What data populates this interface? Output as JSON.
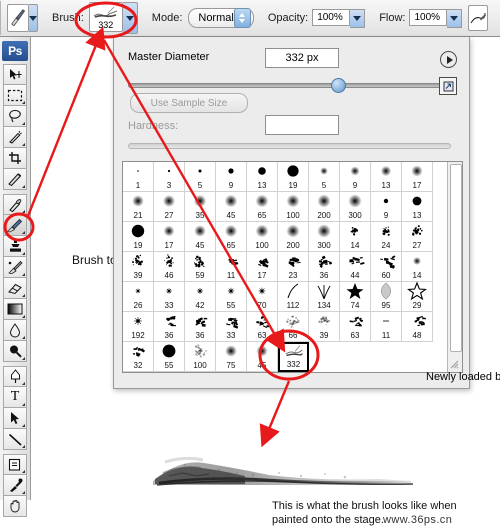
{
  "app": {
    "logo": "Ps"
  },
  "options_bar": {
    "tool_preset_icon": "paintbrush-icon",
    "brush_label": "Brush:",
    "brush_size": "332",
    "mode_label": "Mode:",
    "mode_value": "Normal",
    "opacity_label": "Opacity:",
    "opacity_value": "100%",
    "flow_label": "Flow:",
    "flow_value": "100%",
    "airbrush_icon": "airbrush-icon"
  },
  "toolbar": {
    "tools": [
      {
        "name": "move-tool",
        "icon": "move-icon"
      },
      {
        "name": "marquee-tool",
        "icon": "rect-marquee-icon"
      },
      {
        "name": "lasso-tool",
        "icon": "lasso-icon"
      },
      {
        "name": "magic-wand-tool",
        "icon": "magic-wand-icon"
      },
      {
        "name": "crop-tool",
        "icon": "crop-icon"
      },
      {
        "name": "slice-tool",
        "icon": "slice-icon"
      },
      {
        "name": "healing-brush-tool",
        "icon": "healing-brush-icon"
      },
      {
        "name": "brush-tool",
        "icon": "paintbrush-icon"
      },
      {
        "name": "stamp-tool",
        "icon": "clone-stamp-icon"
      },
      {
        "name": "history-brush-tool",
        "icon": "history-brush-icon"
      },
      {
        "name": "eraser-tool",
        "icon": "eraser-icon"
      },
      {
        "name": "gradient-tool",
        "icon": "gradient-icon"
      },
      {
        "name": "blur-tool",
        "icon": "blur-drop-icon"
      },
      {
        "name": "dodge-tool",
        "icon": "dodge-icon"
      },
      {
        "name": "pen-tool",
        "icon": "pen-icon"
      },
      {
        "name": "type-tool",
        "icon": "type-t-icon"
      },
      {
        "name": "path-selection-tool",
        "icon": "arrow-pointer-icon"
      },
      {
        "name": "line-tool",
        "icon": "line-icon"
      },
      {
        "name": "notes-tool",
        "icon": "note-icon"
      },
      {
        "name": "eyedropper-tool",
        "icon": "eyedropper-icon"
      },
      {
        "name": "hand-tool",
        "icon": "hand-icon"
      }
    ],
    "selected": "brush-tool"
  },
  "brush_panel": {
    "master_diameter_label": "Master Diameter",
    "master_diameter_value": "332 px",
    "diameter_slider_percent": 66,
    "use_sample_size_label": "Use Sample Size",
    "hardness_label": "Hardness:",
    "hardness_value": "",
    "menu_button_icon": "panel-menu-icon",
    "preset_manager_icon": "preset-picker-icon",
    "presets": [
      [
        {
          "size": "1",
          "style": "dot",
          "r": 0.8
        },
        {
          "size": "3",
          "style": "dot",
          "r": 1.1
        },
        {
          "size": "5",
          "style": "dot",
          "r": 1.5
        },
        {
          "size": "9",
          "style": "dot",
          "r": 2.6
        },
        {
          "size": "13",
          "style": "dot",
          "r": 3.8
        },
        {
          "size": "19",
          "style": "dot",
          "r": 5.6
        },
        {
          "size": "5",
          "style": "soft",
          "r": 1.6
        },
        {
          "size": "9",
          "style": "soft",
          "r": 2.4
        },
        {
          "size": "13",
          "style": "soft",
          "r": 3.0
        },
        {
          "size": "17",
          "style": "soft",
          "r": 3.4
        }
      ],
      [
        {
          "size": "21",
          "style": "soft",
          "r": 3.6
        },
        {
          "size": "27",
          "style": "soft",
          "r": 3.8
        },
        {
          "size": "35",
          "style": "soft",
          "r": 4.0
        },
        {
          "size": "45",
          "style": "soft",
          "r": 4.1
        },
        {
          "size": "65",
          "style": "soft",
          "r": 4.2
        },
        {
          "size": "100",
          "style": "soft",
          "r": 4.3
        },
        {
          "size": "200",
          "style": "soft",
          "r": 4.4
        },
        {
          "size": "300",
          "style": "soft",
          "r": 4.5
        },
        {
          "size": "9",
          "style": "dot",
          "r": 2.2
        },
        {
          "size": "13",
          "style": "dot",
          "r": 4.4
        }
      ],
      [
        {
          "size": "19",
          "style": "dot",
          "r": 6.2
        },
        {
          "size": "17",
          "style": "soft",
          "r": 3.2
        },
        {
          "size": "45",
          "style": "soft",
          "r": 3.6
        },
        {
          "size": "65",
          "style": "soft",
          "r": 3.9
        },
        {
          "size": "100",
          "style": "soft",
          "r": 4.2
        },
        {
          "size": "200",
          "style": "soft",
          "r": 4.4
        },
        {
          "size": "300",
          "style": "soft",
          "r": 4.6
        },
        {
          "size": "14",
          "style": "spatter",
          "r": 4.0
        },
        {
          "size": "24",
          "style": "spatter",
          "r": 5.0
        },
        {
          "size": "27",
          "style": "spatter",
          "r": 5.4
        }
      ],
      [
        {
          "size": "39",
          "style": "spatter",
          "r": 6.0
        },
        {
          "size": "46",
          "style": "spatter",
          "r": 6.4
        },
        {
          "size": "59",
          "style": "spatter",
          "r": 6.8
        },
        {
          "size": "11",
          "style": "chalk",
          "r": 3.0
        },
        {
          "size": "17",
          "style": "chalk",
          "r": 4.4
        },
        {
          "size": "23",
          "style": "chalk",
          "r": 5.2
        },
        {
          "size": "36",
          "style": "chalk",
          "r": 5.8
        },
        {
          "size": "44",
          "style": "chalk",
          "r": 6.2
        },
        {
          "size": "60",
          "style": "chalk",
          "r": 6.6
        },
        {
          "size": "14",
          "style": "soft",
          "r": 1.8
        }
      ],
      [
        {
          "size": "26",
          "style": "star",
          "r": 2.4
        },
        {
          "size": "33",
          "style": "star",
          "r": 2.8
        },
        {
          "size": "42",
          "style": "star",
          "r": 3.0
        },
        {
          "size": "55",
          "style": "star",
          "r": 3.2
        },
        {
          "size": "70",
          "style": "star",
          "r": 3.4
        },
        {
          "size": "112",
          "style": "curve",
          "r": 0
        },
        {
          "size": "134",
          "style": "grass",
          "r": 0
        },
        {
          "size": "74",
          "style": "starfill",
          "r": 0
        },
        {
          "size": "95",
          "style": "leaf",
          "r": 0
        },
        {
          "size": "29",
          "style": "staroutline",
          "r": 0
        }
      ],
      [
        {
          "size": "192",
          "style": "star",
          "r": 4.0
        },
        {
          "size": "36",
          "style": "chalk",
          "r": 5.6
        },
        {
          "size": "36",
          "style": "chalk",
          "r": 5.6
        },
        {
          "size": "33",
          "style": "chalk",
          "r": 5.4
        },
        {
          "size": "63",
          "style": "chalk",
          "r": 6.0
        },
        {
          "size": "66",
          "style": "spatterlight",
          "r": 6.4
        },
        {
          "size": "39",
          "style": "spatterlight",
          "r": 5.2
        },
        {
          "size": "63",
          "style": "chalk",
          "r": 6.0
        },
        {
          "size": "11",
          "style": "dash",
          "r": 0
        },
        {
          "size": "48",
          "style": "chalk",
          "r": 5.8
        }
      ],
      [
        {
          "size": "32",
          "style": "chalk",
          "r": 5.4
        },
        {
          "size": "55",
          "style": "dot",
          "r": 6.4
        },
        {
          "size": "100",
          "style": "spatterlight",
          "r": 6.4
        },
        {
          "size": "75",
          "style": "soft",
          "r": 3.6
        },
        {
          "size": "45",
          "style": "soft",
          "r": 3.4
        },
        {
          "size": "332",
          "style": "loaded",
          "r": 0,
          "selected": true
        }
      ]
    ]
  },
  "annotations": {
    "brush_tool_label": "Brush tool",
    "newly_loaded_label": "Newly loaded brush.",
    "caption_line1": "This is what the brush looks like when",
    "caption_line2": "painted onto the stage.",
    "watermark": "www.36ps.cn",
    "accent_color": "#e8191b"
  }
}
